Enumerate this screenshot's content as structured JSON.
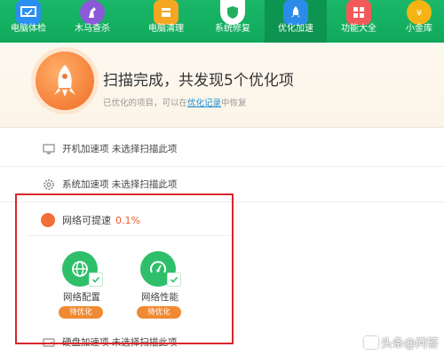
{
  "toolbar": {
    "items": [
      {
        "label": "电脑体检",
        "icon": "monitor-check-icon"
      },
      {
        "label": "木马查杀",
        "icon": "horse-icon"
      },
      {
        "label": "电脑清理",
        "icon": "broom-icon"
      },
      {
        "label": "系统修复",
        "icon": "shield-icon"
      },
      {
        "label": "优化加速",
        "icon": "rocket-icon"
      },
      {
        "label": "功能大全",
        "icon": "grid-icon"
      },
      {
        "label": "小金库",
        "icon": "coin-icon"
      }
    ],
    "active_index": 4
  },
  "header": {
    "title": "扫描完成，共发现5个优化项",
    "sub_prefix": "已优化的项目，可以在",
    "sub_link": "优化记录",
    "sub_suffix": "中恢复"
  },
  "rows": {
    "startup": "开机加速项 未选择扫描此项",
    "system": "系统加速项 未选择扫描此项",
    "disk": "硬盘加速项 未选择扫描此项"
  },
  "network": {
    "title": "网络可提速",
    "percent": "0.1%",
    "options": [
      {
        "name": "网络配置",
        "badge": "待优化",
        "icon": "globe-icon"
      },
      {
        "name": "网络性能",
        "badge": "待优化",
        "icon": "speedometer-icon"
      }
    ]
  },
  "watermark": "头条@问答",
  "colors": {
    "toolbar_green": "#10a85a",
    "accent_orange": "#f05a28",
    "highlight_red": "#d9262e",
    "option_green": "#2fbf6a"
  }
}
